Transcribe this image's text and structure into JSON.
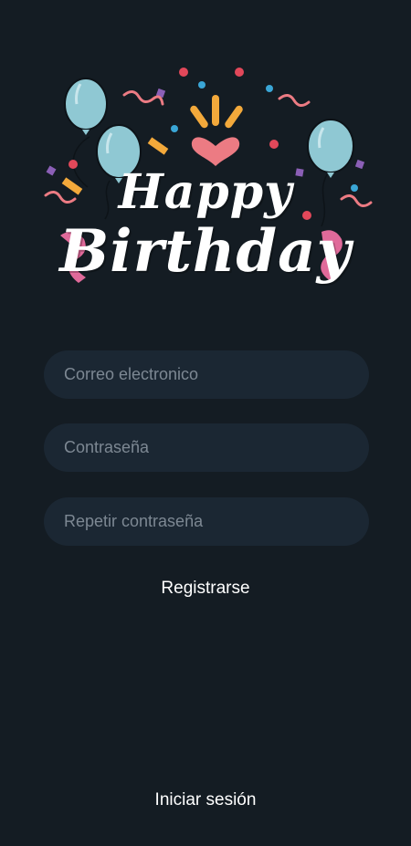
{
  "header": {
    "logo_line1": "Happy",
    "logo_line2": "Birthday"
  },
  "form": {
    "email_placeholder": "Correo electronico",
    "password_placeholder": "Contraseña",
    "repeat_password_placeholder": "Repetir contraseña",
    "register_label": "Registrarse"
  },
  "footer": {
    "login_label": "Iniciar sesión"
  },
  "colors": {
    "background": "#141c23",
    "field_background": "#1b2733",
    "placeholder": "#7d8893",
    "text": "#ffffff",
    "balloon": "#8fc8d3",
    "ribbon": "#e06a9a",
    "accent_orange": "#f3a93b",
    "accent_pink": "#ec7b83",
    "confetti_red": "#e2485a",
    "confetti_blue": "#3aa6d6",
    "confetti_purple": "#8b5fb6"
  }
}
